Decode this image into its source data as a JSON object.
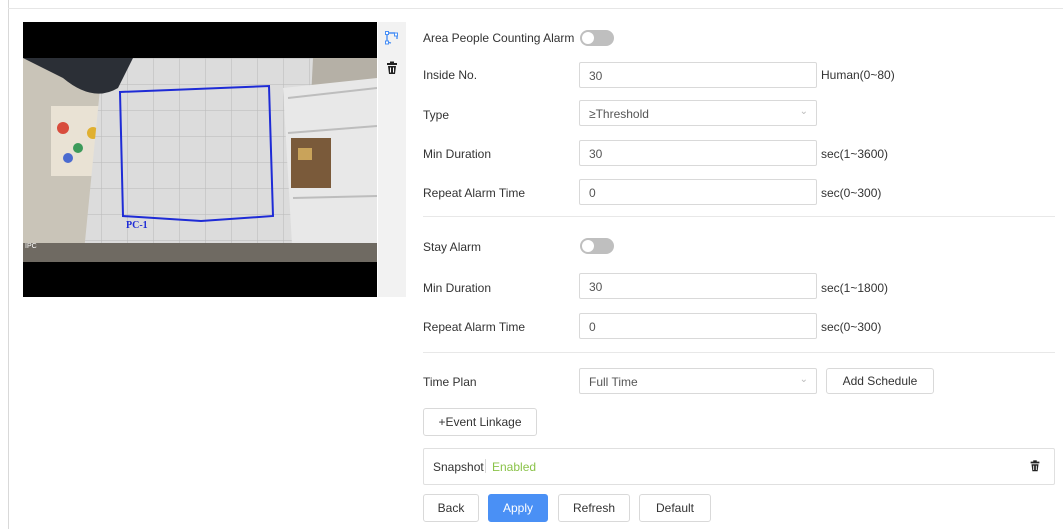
{
  "video": {
    "region_label": "PC-1",
    "overlay_text": "IPC"
  },
  "toolbar": {
    "draw_icon": "draw-region-icon",
    "delete_icon": "trash-icon"
  },
  "form": {
    "area_alarm_label": "Area People Counting Alarm",
    "area_alarm_enabled": false,
    "inside_no": {
      "label": "Inside No.",
      "value": "30",
      "unit": "Human(0~80)"
    },
    "type": {
      "label": "Type",
      "value": "≥Threshold"
    },
    "min_duration_1": {
      "label": "Min Duration",
      "value": "30",
      "unit": "sec(1~3600)"
    },
    "repeat_1": {
      "label": "Repeat Alarm Time",
      "value": "0",
      "unit": "sec(0~300)"
    },
    "stay_alarm_label": "Stay Alarm",
    "stay_alarm_enabled": false,
    "min_duration_2": {
      "label": "Min Duration",
      "value": "30",
      "unit": "sec(1~1800)"
    },
    "repeat_2": {
      "label": "Repeat Alarm Time",
      "value": "0",
      "unit": "sec(0~300)"
    },
    "time_plan": {
      "label": "Time Plan",
      "value": "Full Time",
      "add_label": "Add Schedule"
    },
    "event_linkage_label": "+Event Linkage",
    "snapshot": {
      "label": "Snapshot",
      "status": "Enabled",
      "status_color": "#8bc34a"
    }
  },
  "actions": {
    "back": "Back",
    "apply": "Apply",
    "refresh": "Refresh",
    "default": "Default"
  },
  "colors": {
    "accent": "#4a90f5",
    "region_outline": "#1e2bd6"
  }
}
